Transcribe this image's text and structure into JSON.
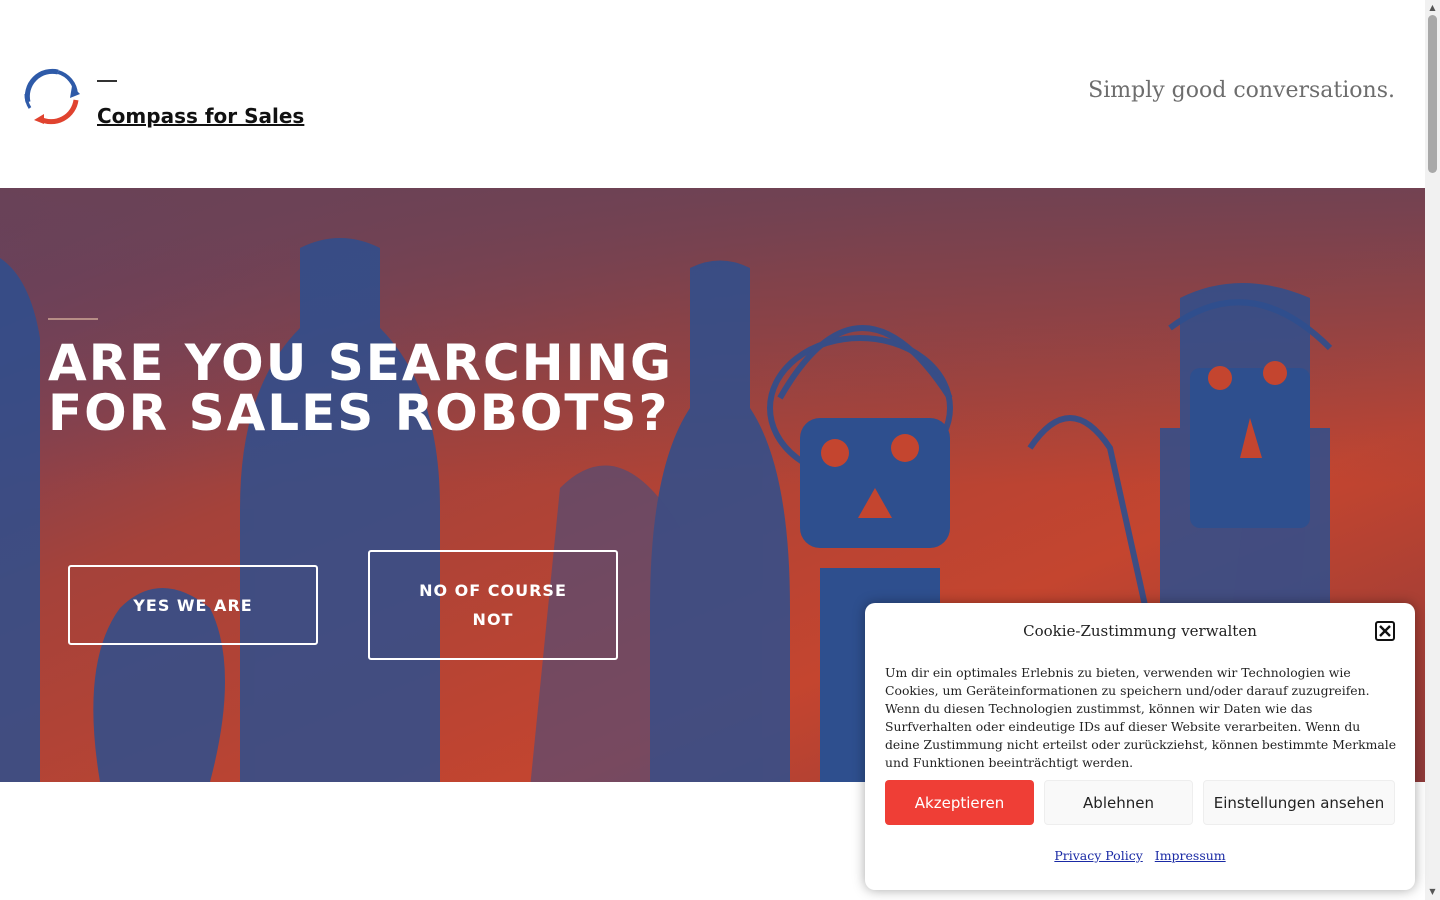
{
  "header": {
    "site_title": "Compass for Sales",
    "tagline": "Simply good conversations."
  },
  "hero": {
    "title": "ARE YOU SEARCHING\nFOR SALES ROBOTS?",
    "button_yes": "YES WE ARE",
    "button_no": "NO OF COURSE NOT"
  },
  "cookie_banner": {
    "title": "Cookie-Zustimmung verwalten",
    "text": "Um dir ein optimales Erlebnis zu bieten, verwenden wir Technologien wie Cookies, um Geräteinformationen zu speichern und/oder darauf zuzugreifen. Wenn du diesen Technologien zustimmst, können wir Daten wie das Surfverhalten oder eindeutige IDs auf dieser Website verarbeiten. Wenn du deine Zustimmung nicht erteilst oder zurückziehst, können bestimmte Merkmale und Funktionen beeinträchtigt werden.",
    "accept_label": "Akzeptieren",
    "deny_label": "Ablehnen",
    "settings_label": "Einstellungen ansehen",
    "privacy_link": "Privacy Policy",
    "imprint_link": "Impressum"
  },
  "colors": {
    "accent_red": "#ef3e36",
    "hero_red": "#c4452f",
    "hero_blue": "#2e4f8e",
    "link_blue": "#1a2aa5"
  },
  "icons": {
    "logo": "circular-arrows-logo",
    "close": "close-x-icon"
  }
}
